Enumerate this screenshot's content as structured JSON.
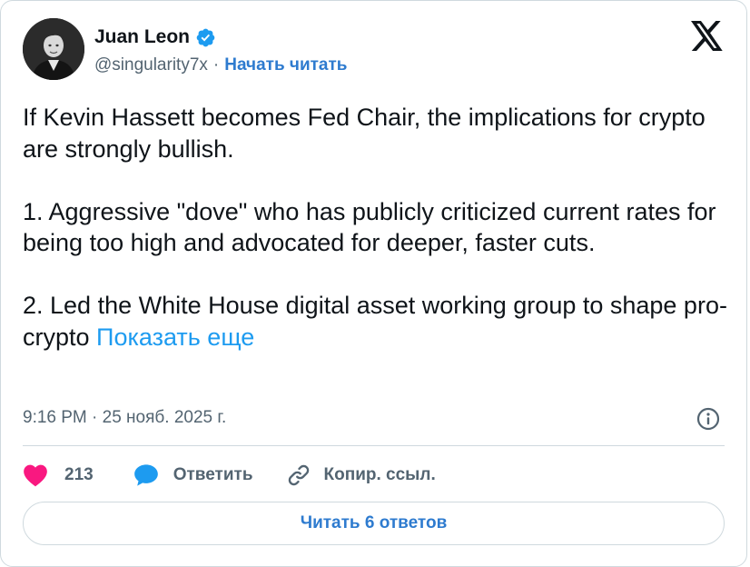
{
  "author": {
    "name": "Juan Leon",
    "handle": "@singularity7x",
    "separator": "·",
    "follow_label": "Начать читать",
    "avatar_icon": "user-photo-avatar",
    "verified_icon": "verified-badge-icon"
  },
  "tweet": {
    "text": "If Kevin Hassett becomes Fed Chair, the implications for crypto are strongly bullish.\n\n1. Aggressive \"dove\" who has publicly criticized current rates for being too high and advocated for deeper, faster cuts.\n\n2. Led the White House digital asset working group to shape pro-crypto ",
    "show_more": "Показать еще",
    "timestamp": "9:16 PM · 25 нояб. 2025 г."
  },
  "actions": {
    "like_count": "213",
    "reply_label": "Ответить",
    "copy_link_label": "Копир. ссыл."
  },
  "replies_button": "Читать 6 ответов",
  "colors": {
    "accent": "#1d9bf0",
    "link_dark": "#2e7bcf",
    "like": "#f91880",
    "reply": "#1d9bf0",
    "muted": "#536471",
    "border": "#cfd9de"
  }
}
